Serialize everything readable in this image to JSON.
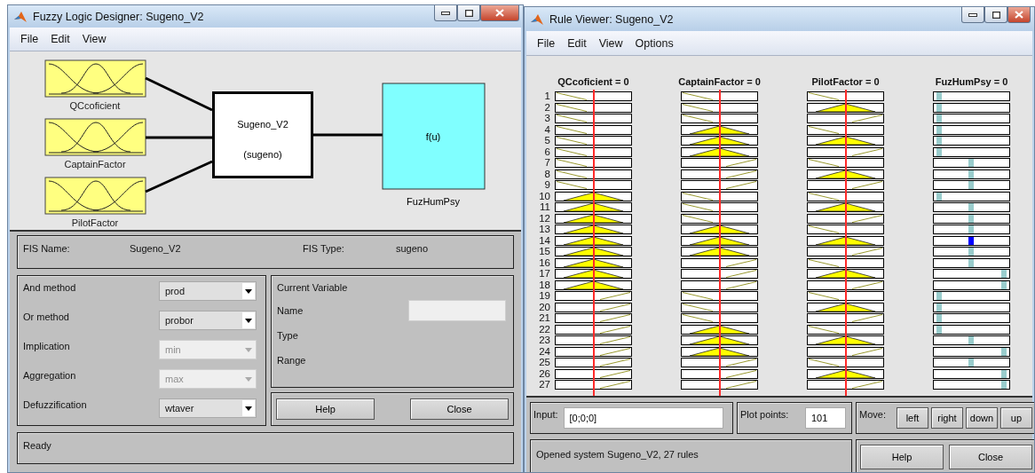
{
  "designer": {
    "title": "Fuzzy Logic Designer: Sugeno_V2",
    "menu": [
      "File",
      "Edit",
      "View"
    ],
    "inputs": [
      "QCcoficient",
      "CaptainFactor",
      "PilotFactor"
    ],
    "system": {
      "name": "Sugeno_V2",
      "type": "(sugeno)"
    },
    "output": {
      "function": "f(u)",
      "name": "FuzHumPsy"
    },
    "fis_name_label": "FIS Name:",
    "fis_name": "Sugeno_V2",
    "fis_type_label": "FIS Type:",
    "fis_type": "sugeno",
    "methods": [
      {
        "label": "And method",
        "value": "prod",
        "disabled": false
      },
      {
        "label": "Or method",
        "value": "probor",
        "disabled": false
      },
      {
        "label": "Implication",
        "value": "min",
        "disabled": true
      },
      {
        "label": "Aggregation",
        "value": "max",
        "disabled": true
      },
      {
        "label": "Defuzzification",
        "value": "wtaver",
        "disabled": false
      }
    ],
    "current_variable": {
      "title": "Current Variable",
      "name_label": "Name",
      "type_label": "Type",
      "range_label": "Range"
    },
    "buttons": [
      "Help",
      "Close"
    ],
    "status": "Ready"
  },
  "rule_viewer": {
    "title": "Rule Viewer: Sugeno_V2",
    "menu": [
      "File",
      "Edit",
      "View",
      "Options"
    ],
    "columns": [
      "QCcoficient = 0",
      "CaptainFactor = 0",
      "PilotFactor = 0",
      "FuzHumPsy = 0"
    ],
    "rules": [
      {
        "number": "1",
        "inputs": [
          {
            "kind": "low"
          },
          {
            "kind": "low"
          },
          {
            "kind": "low"
          }
        ],
        "output": {
          "kind": "low",
          "fired": false
        }
      },
      {
        "number": "2",
        "inputs": [
          {
            "kind": "low"
          },
          {
            "kind": "low"
          },
          {
            "kind": "mid"
          }
        ],
        "output": {
          "kind": "low",
          "fired": false
        }
      },
      {
        "number": "3",
        "inputs": [
          {
            "kind": "low"
          },
          {
            "kind": "low"
          },
          {
            "kind": "high"
          }
        ],
        "output": {
          "kind": "low",
          "fired": false
        }
      },
      {
        "number": "4",
        "inputs": [
          {
            "kind": "low"
          },
          {
            "kind": "mid"
          },
          {
            "kind": "low"
          }
        ],
        "output": {
          "kind": "low",
          "fired": false
        }
      },
      {
        "number": "5",
        "inputs": [
          {
            "kind": "low"
          },
          {
            "kind": "mid"
          },
          {
            "kind": "mid"
          }
        ],
        "output": {
          "kind": "low",
          "fired": false
        }
      },
      {
        "number": "6",
        "inputs": [
          {
            "kind": "low"
          },
          {
            "kind": "mid"
          },
          {
            "kind": "high"
          }
        ],
        "output": {
          "kind": "low",
          "fired": false
        }
      },
      {
        "number": "7",
        "inputs": [
          {
            "kind": "low"
          },
          {
            "kind": "high"
          },
          {
            "kind": "low"
          }
        ],
        "output": {
          "kind": "mid",
          "fired": false
        }
      },
      {
        "number": "8",
        "inputs": [
          {
            "kind": "low"
          },
          {
            "kind": "high"
          },
          {
            "kind": "mid"
          }
        ],
        "output": {
          "kind": "mid",
          "fired": false
        }
      },
      {
        "number": "9",
        "inputs": [
          {
            "kind": "low"
          },
          {
            "kind": "high"
          },
          {
            "kind": "high"
          }
        ],
        "output": {
          "kind": "mid",
          "fired": false
        }
      },
      {
        "number": "10",
        "inputs": [
          {
            "kind": "mid"
          },
          {
            "kind": "low"
          },
          {
            "kind": "low"
          }
        ],
        "output": {
          "kind": "low",
          "fired": false
        }
      },
      {
        "number": "11",
        "inputs": [
          {
            "kind": "mid"
          },
          {
            "kind": "low"
          },
          {
            "kind": "mid"
          }
        ],
        "output": {
          "kind": "mid",
          "fired": false
        }
      },
      {
        "number": "12",
        "inputs": [
          {
            "kind": "mid"
          },
          {
            "kind": "low"
          },
          {
            "kind": "high"
          }
        ],
        "output": {
          "kind": "mid",
          "fired": false
        }
      },
      {
        "number": "13",
        "inputs": [
          {
            "kind": "mid"
          },
          {
            "kind": "mid"
          },
          {
            "kind": "low"
          }
        ],
        "output": {
          "kind": "mid",
          "fired": false
        }
      },
      {
        "number": "14",
        "inputs": [
          {
            "kind": "mid"
          },
          {
            "kind": "mid"
          },
          {
            "kind": "mid"
          }
        ],
        "output": {
          "kind": "mid",
          "fired": true
        }
      },
      {
        "number": "15",
        "inputs": [
          {
            "kind": "mid"
          },
          {
            "kind": "mid"
          },
          {
            "kind": "high"
          }
        ],
        "output": {
          "kind": "mid",
          "fired": false
        }
      },
      {
        "number": "16",
        "inputs": [
          {
            "kind": "mid"
          },
          {
            "kind": "high"
          },
          {
            "kind": "low"
          }
        ],
        "output": {
          "kind": "mid",
          "fired": false
        }
      },
      {
        "number": "17",
        "inputs": [
          {
            "kind": "mid"
          },
          {
            "kind": "high"
          },
          {
            "kind": "mid"
          }
        ],
        "output": {
          "kind": "high",
          "fired": false
        }
      },
      {
        "number": "18",
        "inputs": [
          {
            "kind": "mid"
          },
          {
            "kind": "high"
          },
          {
            "kind": "high"
          }
        ],
        "output": {
          "kind": "high",
          "fired": false
        }
      },
      {
        "number": "19",
        "inputs": [
          {
            "kind": "high"
          },
          {
            "kind": "low"
          },
          {
            "kind": "low"
          }
        ],
        "output": {
          "kind": "low",
          "fired": false
        }
      },
      {
        "number": "20",
        "inputs": [
          {
            "kind": "high"
          },
          {
            "kind": "low"
          },
          {
            "kind": "mid"
          }
        ],
        "output": {
          "kind": "low",
          "fired": false
        }
      },
      {
        "number": "21",
        "inputs": [
          {
            "kind": "high"
          },
          {
            "kind": "low"
          },
          {
            "kind": "high"
          }
        ],
        "output": {
          "kind": "low",
          "fired": false
        }
      },
      {
        "number": "22",
        "inputs": [
          {
            "kind": "high"
          },
          {
            "kind": "mid"
          },
          {
            "kind": "low"
          }
        ],
        "output": {
          "kind": "low",
          "fired": false
        }
      },
      {
        "number": "23",
        "inputs": [
          {
            "kind": "high"
          },
          {
            "kind": "mid"
          },
          {
            "kind": "mid"
          }
        ],
        "output": {
          "kind": "mid",
          "fired": false
        }
      },
      {
        "number": "24",
        "inputs": [
          {
            "kind": "high"
          },
          {
            "kind": "mid"
          },
          {
            "kind": "high"
          }
        ],
        "output": {
          "kind": "high",
          "fired": false
        }
      },
      {
        "number": "25",
        "inputs": [
          {
            "kind": "high"
          },
          {
            "kind": "high"
          },
          {
            "kind": "low"
          }
        ],
        "output": {
          "kind": "mid",
          "fired": false
        }
      },
      {
        "number": "26",
        "inputs": [
          {
            "kind": "high"
          },
          {
            "kind": "high"
          },
          {
            "kind": "mid"
          }
        ],
        "output": {
          "kind": "high",
          "fired": false
        }
      },
      {
        "number": "27",
        "inputs": [
          {
            "kind": "high"
          },
          {
            "kind": "high"
          },
          {
            "kind": "high"
          }
        ],
        "output": {
          "kind": "high",
          "fired": false
        }
      }
    ],
    "input_label": "Input:",
    "input_value": "[0;0;0]",
    "plot_points_label": "Plot points:",
    "plot_points": "101",
    "move_label": "Move:",
    "move_buttons": [
      "left",
      "right",
      "down",
      "up"
    ],
    "status": "Opened system Sugeno_V2, 27 rules",
    "buttons": [
      "Help",
      "Close"
    ]
  }
}
